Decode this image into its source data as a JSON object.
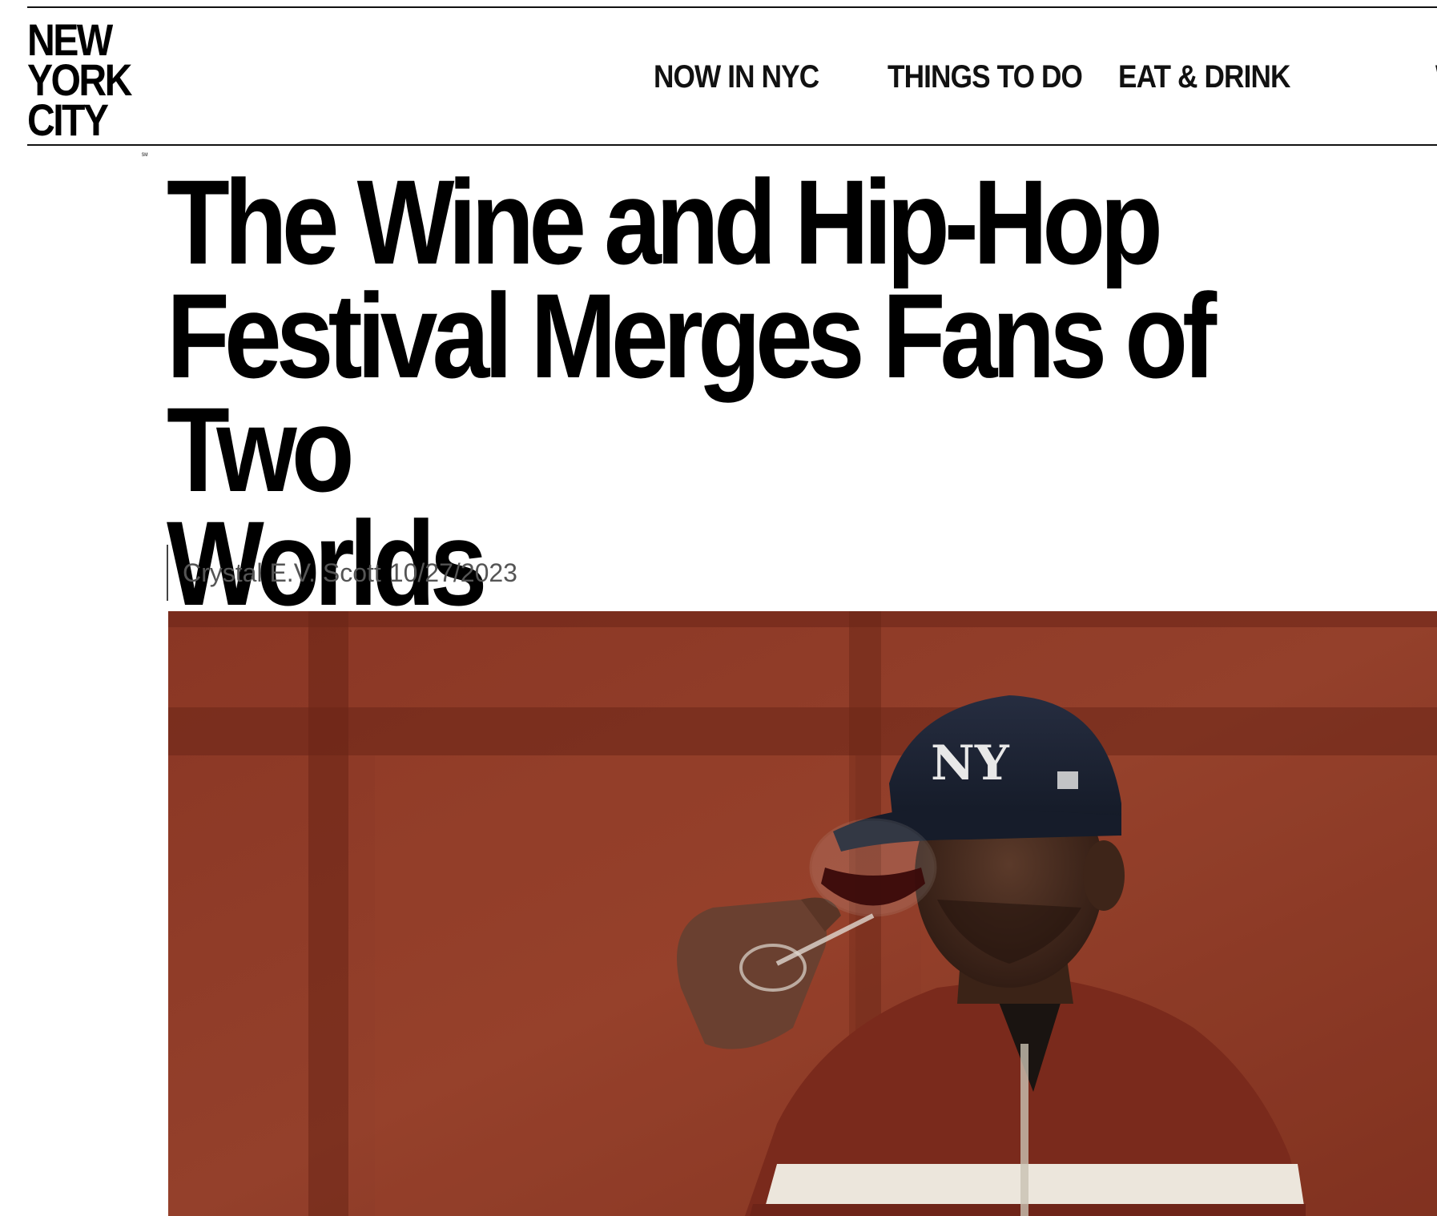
{
  "header": {
    "logo": {
      "line1": "NEW",
      "line2": "YORK",
      "line3": "CITY",
      "trademark": "SM"
    },
    "nav": [
      {
        "label": "NOW IN NYC"
      },
      {
        "label": "THINGS TO DO"
      },
      {
        "label": "EAT & DRINK"
      },
      {
        "label": "W"
      }
    ]
  },
  "article": {
    "title": "The Wine and Hip-Hop Festival Merges Fans of Two Worlds",
    "title_lines": [
      "The Wine and Hip-Hop",
      "Festival Merges Fans of Two",
      "Worlds"
    ],
    "author": "Crystal E.V. Scott",
    "date": "10/27/2023",
    "hero_image": {
      "subject": "man-in-yankees-cap-tasting-red-wine",
      "cap_logo": "NY"
    }
  },
  "colors": {
    "background": "#ffffff",
    "text": "#000000",
    "byline_text": "#555555",
    "hero_wall": "#8e3a27",
    "cap_navy": "#1b2233",
    "jacket_red": "#7a2a1c"
  }
}
